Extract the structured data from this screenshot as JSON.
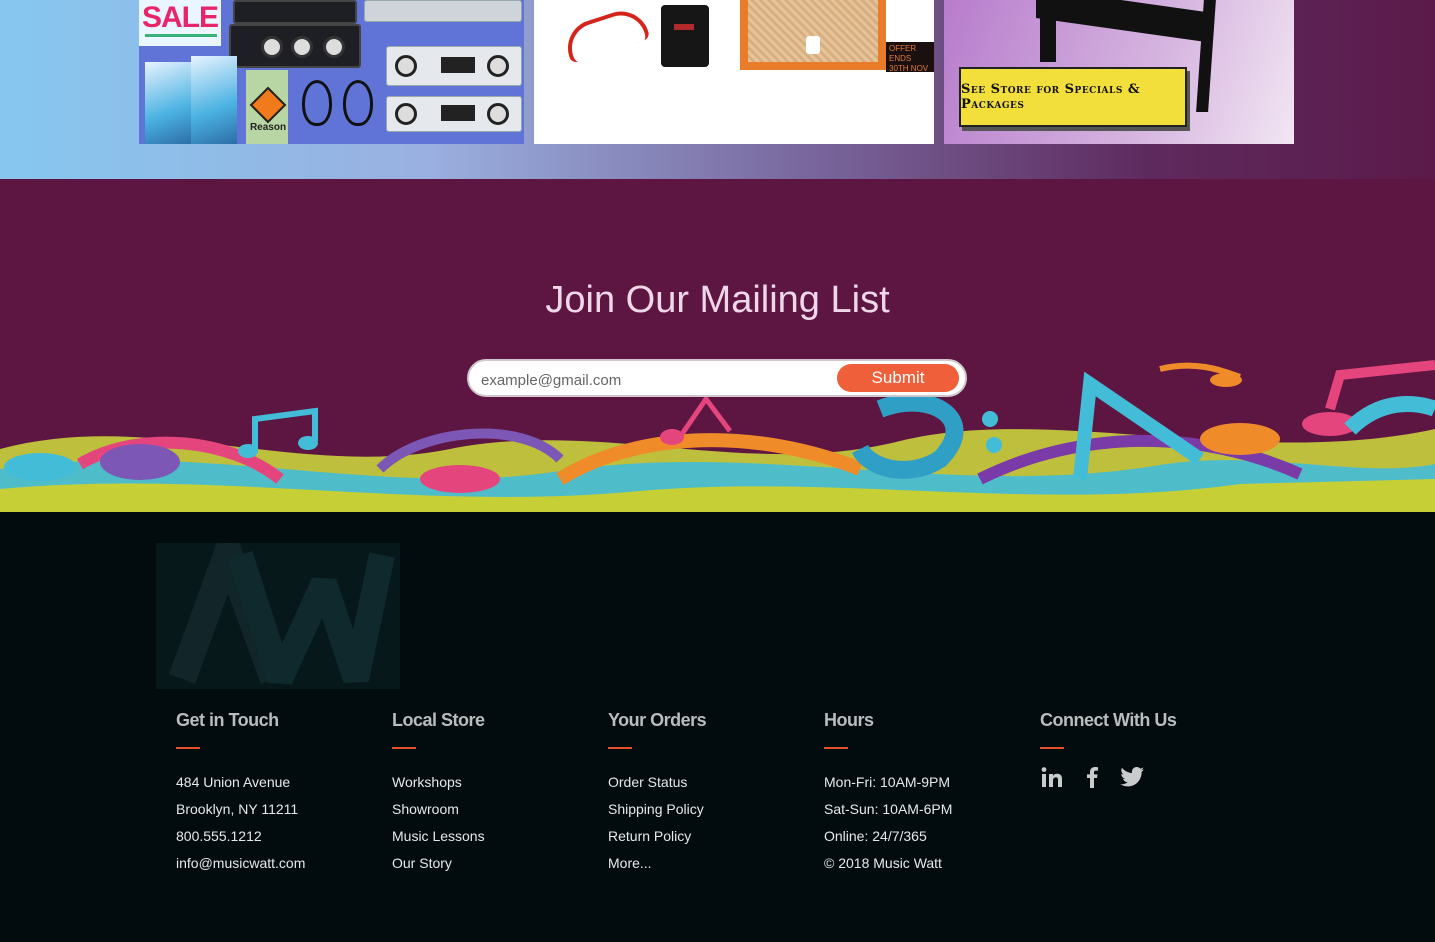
{
  "promos": {
    "sale_badge": "SALE",
    "reason_label": "Reason",
    "offer_text": "OFFER ENDS 30TH NOV",
    "specials_label": "See Store for Specials & Packages"
  },
  "mailing": {
    "title": "Join Our Mailing List",
    "email_placeholder": "example@gmail.com",
    "submit_label": "Submit"
  },
  "footer": {
    "columns": [
      {
        "heading": "Get in Touch",
        "items": [
          "484 Union Avenue",
          "Brooklyn, NY 11211",
          "800.555.1212",
          "info@musicwatt.com"
        ]
      },
      {
        "heading": "Local Store",
        "items": [
          "Workshops",
          "Showroom",
          "Music Lessons",
          "Our Story"
        ]
      },
      {
        "heading": "Your Orders",
        "items": [
          "Order Status",
          "Shipping Policy",
          "Return Policy",
          "More..."
        ]
      },
      {
        "heading": "Hours",
        "items": [
          "Mon-Fri: 10AM-9PM",
          "Sat-Sun: 10AM-6PM",
          "Online: 24/7/365",
          "© 2018 Music Watt"
        ]
      },
      {
        "heading": "Connect With Us",
        "items": []
      }
    ],
    "social_icons": [
      "linkedin-icon",
      "facebook-icon",
      "twitter-icon"
    ]
  },
  "colors": {
    "mailing_bg": "#5d1642",
    "submit_bg": "#ef5f3a",
    "footer_bg": "#020c0e",
    "accent_rule": "#e3502e"
  }
}
